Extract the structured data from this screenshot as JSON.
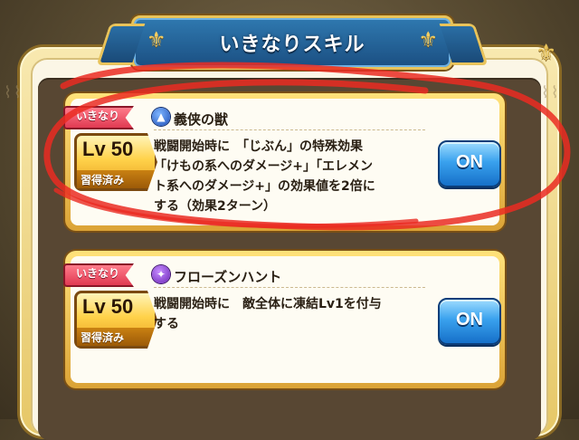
{
  "header": {
    "title": "いきなりスキル"
  },
  "skills": [
    {
      "tag": "いきなり",
      "level": "Lv 50",
      "status": "習得済み",
      "icon": "blue-skill-emblem-icon",
      "name": "義侠の獣",
      "description_lines": [
        "戦闘開始時に　「じぶん」の特殊効果",
        "「けもの系へのダメージ+」「エレメン",
        "ト系へのダメージ+」の効果値を2倍に",
        "する（効果2ターン）"
      ],
      "toggle": "ON"
    },
    {
      "tag": "いきなり",
      "level": "Lv 50",
      "status": "習得済み",
      "icon": "purple-skill-emblem-icon",
      "name": "フローズンハント",
      "description_lines": [
        "戦闘開始時に　敵全体に凍結Lv1を付与",
        "する"
      ],
      "toggle": "ON"
    }
  ],
  "colors": {
    "banner": "#1b4f82",
    "on_button": "#3aa2ee",
    "ribbon": "#e03a52",
    "annotation_stroke": "#ea2b22"
  }
}
